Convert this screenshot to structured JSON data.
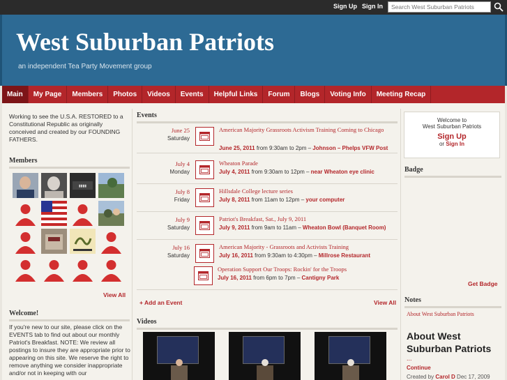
{
  "topbar": {
    "signup": "Sign Up",
    "signin": "Sign In",
    "search_placeholder": "Search West Suburban Patriots"
  },
  "header": {
    "title": "West Suburban Patriots",
    "tagline": "an independent Tea Party Movement group"
  },
  "nav": [
    "Main",
    "My Page",
    "Members",
    "Photos",
    "Videos",
    "Events",
    "Helpful Links",
    "Forum",
    "Blogs",
    "Voting Info",
    "Meeting Recap"
  ],
  "intro": "Working to see the U.S.A. RESTORED to a Constitutional Republic as originally conceived and created by our FOUNDING FATHERS.",
  "members": {
    "title": "Members",
    "view_all": "View All"
  },
  "welcome": {
    "title": "Welcome!",
    "text": "If you're new to our site, please click on the EVENTS tab to find out about our monthly Patriot's Breakfast. NOTE: We review all postings to insure they are appropriate prior to appearing on this site. We reserve the right to remove anything we consider inappropriate and/or not in keeping with our"
  },
  "events": {
    "title": "Events",
    "add": "+ Add an Event",
    "view_all": "View All",
    "items": [
      {
        "date": "June 25",
        "day": "Saturday",
        "title": "American Majority Grassroots Activism Training Coming to Chicago",
        "when": "June 25, 2011",
        "time": " from 9:30am to 2pm – ",
        "where": "Johnson – Phelps VFW Post"
      },
      {
        "date": "July 4",
        "day": "Monday",
        "title": "Wheaton Parade",
        "when": "July 4, 2011",
        "time": " from 9:30am to 12pm – ",
        "where": "near Wheaton eye clinic"
      },
      {
        "date": "July 8",
        "day": "Friday",
        "title": "Hillsdale College lecture series",
        "when": "July 8, 2011",
        "time": " from 11am to 12pm – ",
        "where": "your computer"
      },
      {
        "date": "July 9",
        "day": "Saturday",
        "title": "Patriot's Breakfast, Sat., July 9, 2011",
        "when": "July 9, 2011",
        "time": " from 9am to 11am – ",
        "where": "Wheaton Bowl (Banquet Room)"
      },
      {
        "date": "July 16",
        "day": "Saturday",
        "title": "American Majority - Grassroots and Activists Training",
        "when": "July 16, 2011",
        "time": " from 9:30am to 4:30pm – ",
        "where": "Millrose Restaurant"
      },
      {
        "date": "",
        "day": "",
        "title": "Operation Support Our Troops: Rockin' for the Troops",
        "when": "July 16, 2011",
        "time": " from 6pm to 7pm – ",
        "where": "Cantigny Park"
      }
    ]
  },
  "videos": {
    "title": "Videos"
  },
  "welcome_box": {
    "line1": "Welcome to",
    "line2": "West Suburban Patriots",
    "signup": "Sign Up",
    "or": "or ",
    "signin": "Sign In"
  },
  "badge": {
    "title": "Badge",
    "get": "Get Badge"
  },
  "notes": {
    "title": "Notes",
    "link": "About West Suburban Patriots",
    "heading": "About West Suburban Patriots",
    "dots": "...",
    "continue": "Continue",
    "created_prefix": "Created by ",
    "author": "Carol D",
    "date": " Dec 17, 2009"
  },
  "colors": {
    "brand_red": "#b3262a",
    "header_blue": "#2d6a94",
    "topbar": "#2b2b2b"
  }
}
